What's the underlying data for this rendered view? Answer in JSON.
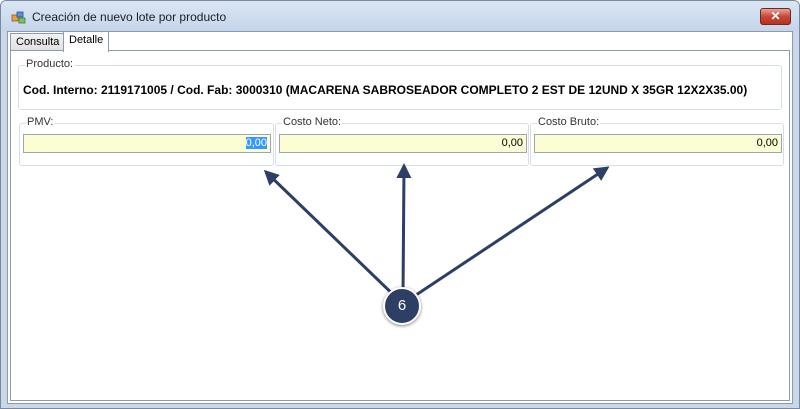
{
  "window": {
    "title": "Creación de nuevo lote por producto",
    "close_label": "✕"
  },
  "tabs": [
    {
      "label": "Consulta",
      "active": false
    },
    {
      "label": "Detalle",
      "active": true
    }
  ],
  "producto": {
    "caption": "Producto:",
    "text": "Cod. Interno: 2119171005 / Cod. Fab: 3000310 (MACARENA SABROSEADOR COMPLETO  2 EST DE 12UND X 35GR 12X2X35.00)"
  },
  "fields": [
    {
      "caption": "PMV:",
      "value": "0,00",
      "selected": true
    },
    {
      "caption": "Costo Neto:",
      "value": "0,00",
      "selected": false
    },
    {
      "caption": "Costo Bruto:",
      "value": "0,00",
      "selected": false
    }
  ],
  "callout": {
    "number": "6",
    "color": "#2d3f64"
  }
}
